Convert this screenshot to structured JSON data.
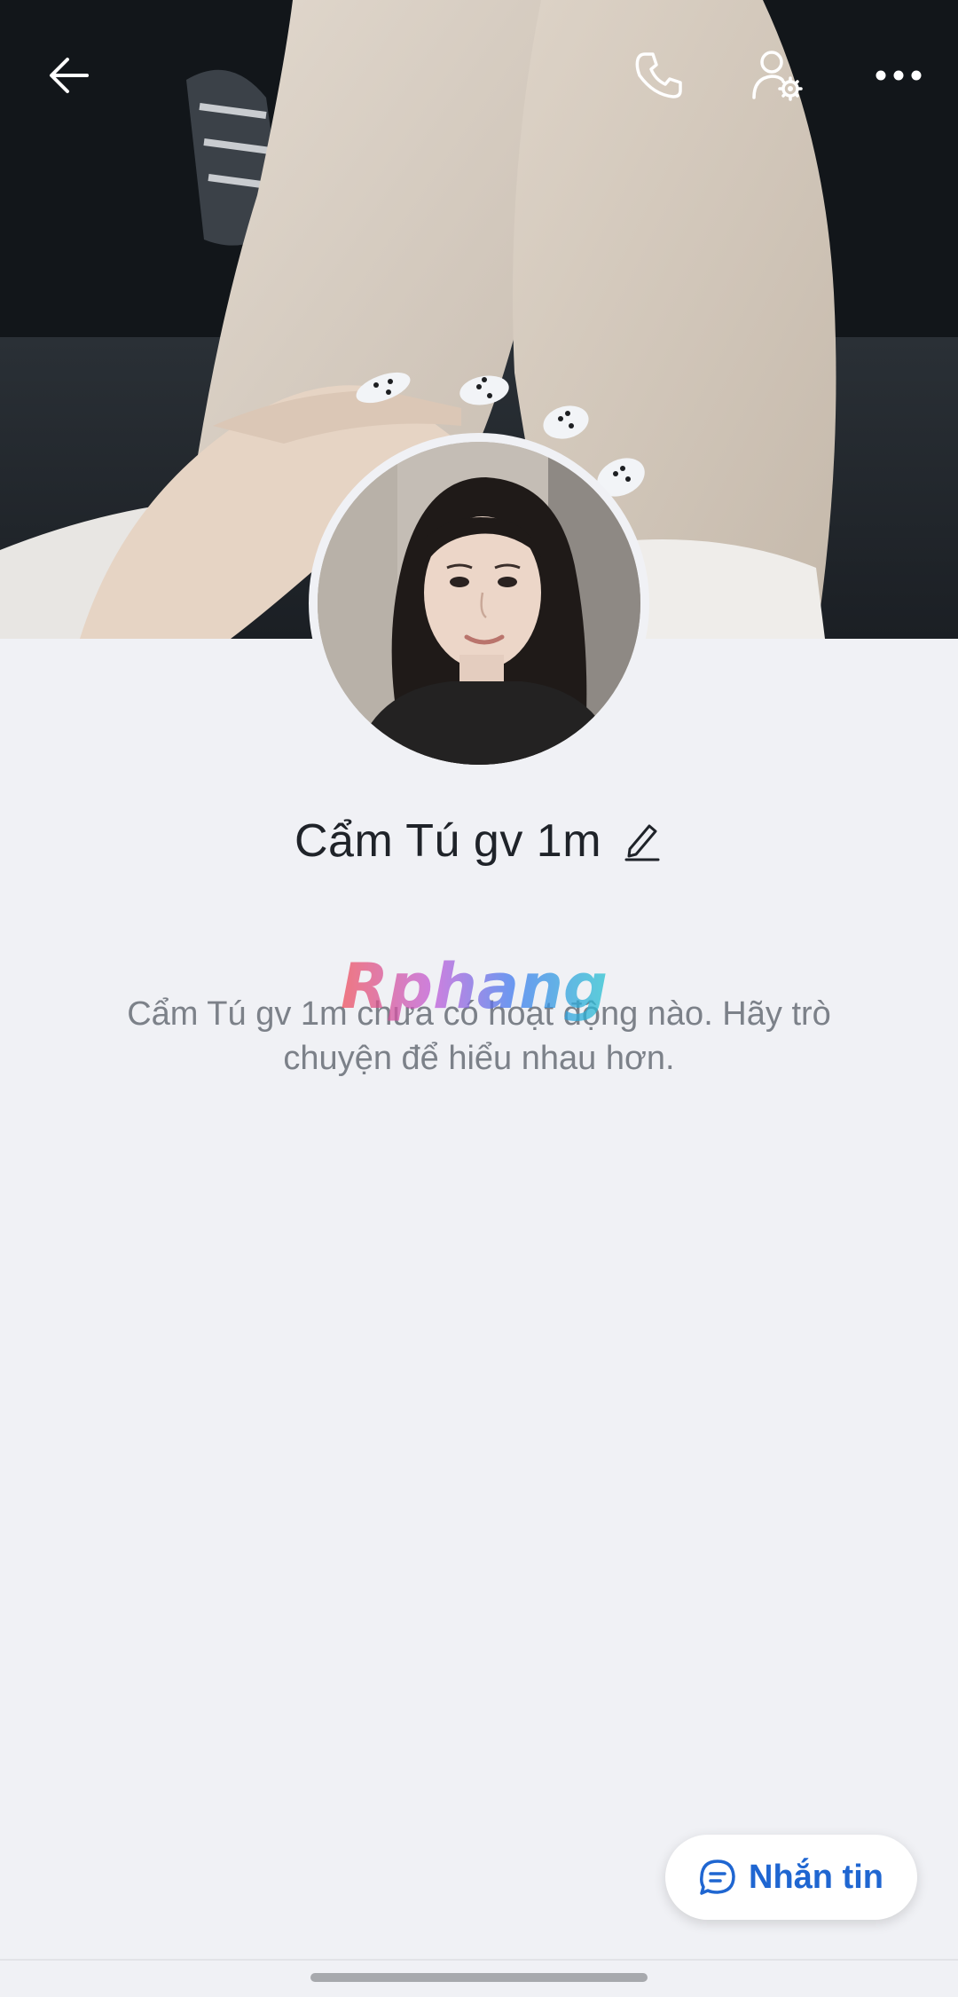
{
  "profile": {
    "name": "Cẩm Tú gv 1m",
    "empty_message": "Cẩm Tú gv 1m chưa có hoạt động nào. Hãy trò chuyện để hiểu nhau hơn."
  },
  "topbar": {
    "back_icon": "arrow-left-icon",
    "call_icon": "phone-icon",
    "settings_icon": "user-settings-icon",
    "more_icon": "more-horizontal-icon"
  },
  "actions": {
    "message_label": "Nhắn tin",
    "message_icon": "chat-bubble-icon"
  },
  "watermark": {
    "text": "Rphang"
  },
  "colors": {
    "accent": "#1f66d1",
    "background": "#f0f1f5",
    "name_text": "#1f2329",
    "muted_text": "#7c8189"
  }
}
